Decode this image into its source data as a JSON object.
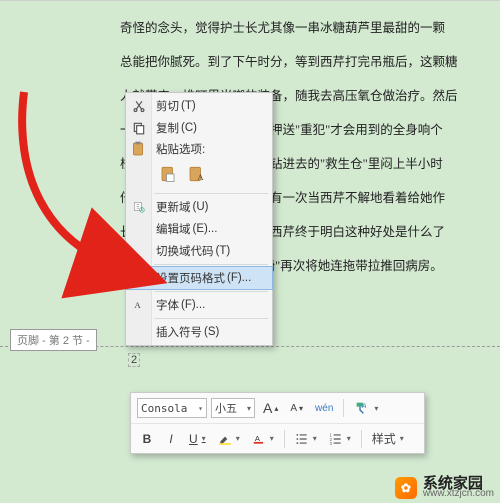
{
  "doc": {
    "lines": [
      "奇怪的念头，觉得护士长尤其像一串冰糖葫芦里最甜的一颗",
      "总能把你腻死。到了下午时分，等到西芹打完吊瓶后，这颗糖",
      "人就带来一堆叮里当啷的装备，随我去高压氧仓做治疗。然后",
      "一路吆喝小护士让道，颇有押送\"重犯\"才会用到的全身响个",
      "栈就把她跟大铁罐子一块儿钻进去的\"救生仓\"里闷上半小时",
      "倍。在里边除了耳膜发胀，有一次当西芹不解地看着给她作",
      "长时，护士长反而笑了笑，西芹终于明白这种好处是什么了",
      "不过是每次例行出仓后\"轮椅\"再次将她连拖带拉推回病房。"
    ]
  },
  "footer": {
    "label": "页脚 - 第 2 节 -",
    "page_number": "2"
  },
  "context_menu": {
    "cut": {
      "label": "剪切",
      "kbd": "(T)"
    },
    "copy": {
      "label": "复制",
      "kbd": "(C)"
    },
    "paste_opts": {
      "label": "粘贴选项:"
    },
    "update_fld": {
      "label": "更新域",
      "kbd": "(U)"
    },
    "edit_fld": {
      "label": "编辑域",
      "kbd": "(E)..."
    },
    "toggle_code": {
      "label": "切换域代码",
      "kbd": "(T)"
    },
    "page_fmt": {
      "label": "设置页码格式",
      "kbd": "(F)..."
    },
    "font": {
      "label": "字体",
      "kbd": "(F)..."
    },
    "ins_symbol": {
      "label": "插入符号",
      "kbd": "(S)"
    }
  },
  "minibar": {
    "font_name": "Consola",
    "font_size": "小五",
    "grow": "A",
    "shrink": "A",
    "wenzi": "wén",
    "fmt_painter": "format-painter",
    "styles_label": "样式",
    "bold": "B",
    "italic": "I",
    "underline": "U"
  },
  "watermark": {
    "title": "系统家园",
    "sub": "www.xtzjcn.com",
    "logo_glyph": "✿"
  }
}
